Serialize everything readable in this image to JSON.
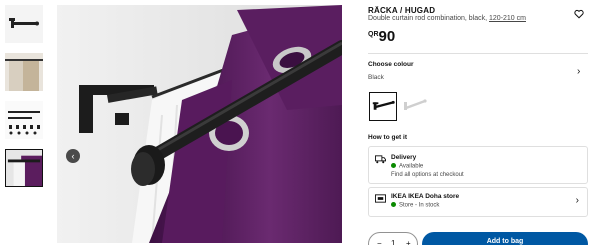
{
  "product": {
    "name": "RÄCKA / HUGAD",
    "desc_main": "Double curtain rod combination, black, ",
    "desc_size": "120-210 cm",
    "price_currency": "QR",
    "price_amount": "90"
  },
  "colour": {
    "label": "Choose colour",
    "value": "Black"
  },
  "get_it": {
    "label": "How to get it"
  },
  "delivery": {
    "title": "Delivery",
    "status": "Available",
    "note": "Find all options at checkout"
  },
  "store": {
    "title": "IKEA IKEA Doha store",
    "status": "Store - In stock"
  },
  "purchase": {
    "quantity": "1",
    "minus": "−",
    "plus": "+",
    "add_label": "Add to bag"
  },
  "icons": {
    "prev": "chevron-left-icon",
    "favourite": "heart-icon",
    "chevron": "chevron-right-icon",
    "delivery": "truck-icon",
    "store": "store-icon"
  },
  "colors": {
    "accent": "#0058a3",
    "in_stock": "#0a8a00",
    "curtain": "#5b1d5e"
  }
}
